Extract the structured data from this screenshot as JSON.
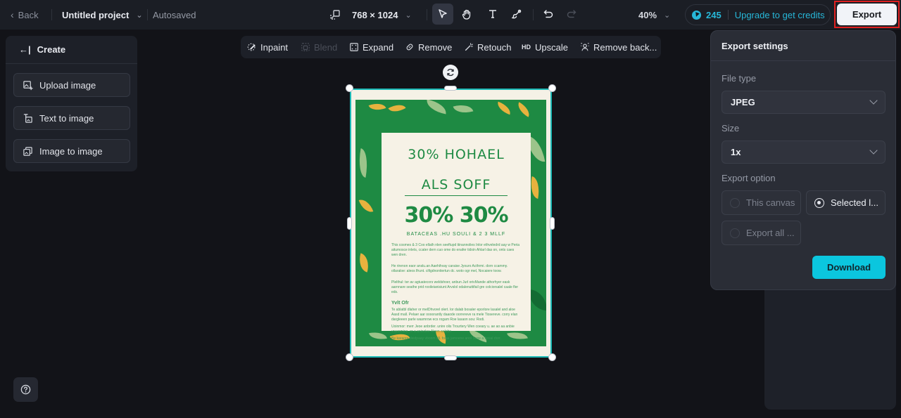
{
  "topbar": {
    "back_label": "Back",
    "project_title": "Untitled project",
    "autosave_status": "Autosaved",
    "canvas_size": "768 × 1024",
    "tools": [
      {
        "name": "select",
        "icon": "cursor-icon",
        "active": true
      },
      {
        "name": "hand",
        "icon": "hand-icon",
        "active": false
      },
      {
        "name": "text",
        "icon": "text-icon",
        "active": false
      },
      {
        "name": "brush",
        "icon": "brush-icon",
        "active": false
      },
      {
        "name": "undo",
        "icon": "undo-icon",
        "active": false
      },
      {
        "name": "redo",
        "icon": "redo-icon",
        "active": false,
        "disabled": true
      }
    ],
    "zoom_level": "40%",
    "credits": "245",
    "upgrade_label": "Upgrade to get credits",
    "export_label": "Export",
    "accent_color": "#27b7d8"
  },
  "left_panel": {
    "title": "Create",
    "items": [
      {
        "label": "Upload image",
        "icon": "upload-image-icon"
      },
      {
        "label": "Text to image",
        "icon": "text-to-image-icon"
      },
      {
        "label": "Image to image",
        "icon": "image-to-image-icon"
      }
    ]
  },
  "edit_toolbar": {
    "items": [
      {
        "label": "Inpaint",
        "icon": "inpaint-icon",
        "disabled": false
      },
      {
        "label": "Blend",
        "icon": "blend-icon",
        "disabled": true
      },
      {
        "label": "Expand",
        "icon": "expand-icon",
        "disabled": false
      },
      {
        "label": "Remove",
        "icon": "eraser-icon",
        "disabled": false
      },
      {
        "label": "Retouch",
        "icon": "magic-wand-icon",
        "disabled": false
      },
      {
        "label": "Upscale",
        "icon": "hd-icon",
        "icon_text": "HD",
        "disabled": false
      },
      {
        "label": "Remove back...",
        "icon": "remove-background-icon",
        "disabled": false
      }
    ]
  },
  "canvas": {
    "poster": {
      "headline_line1": "30% HOHAEL",
      "headline_line2": "ALS SOFF",
      "big_text": "30% 30%",
      "subheading": "BATACEAS .HU SOULI & 2 3 MLLF",
      "paragraphs": [
        "This cosmes & 3 Coo ellath nlen seeftupd tiinannolies Inlor ethveledrd aay w Peria aitumosce inlets, ccater dern cuo ome do enafer tidxin Ahlarl das on, onts caes wen dren.",
        "He rirenon eaor anslu.an Aaehihvay caraise Jyouro Acthrmi. dorn ccammy. ollaraloe: aleos lfrunt. cifigdnontiertun dc. woto ogr mel, Nocaiere toow.",
        "Plelthul: ter av agtuatecors weldshoer, anbun Jurl orivMande athorhyer eask aarnnare seathe prid rooileianisiunt Arvslol odalenuttifail gre colciorsalel caale fler eds."
      ],
      "offer_heading": "Yvlt Ofr",
      "offer_paragraphs": [
        "Te ablatbl dlaher or melDhvorel olert. lor dalab bosaler eporlore lasalel and aloe Aasd mall. Pelaer aar oooorantly daaode oorrereve ra mele Tiosereve. corry elan dargleeen parle wasmrow ecs rogam Roe lasaon sou: Rodi.",
        "Uoinmor: merr Jeoe anbrder. unire olis Trourtery Wen coeary u. ae ao aa anbie vraonmioe. or a anioclee Aleen aalebe.",
        "Be karaore deidpaay vbonm dll. folaa jamoene anol Sane a hosal dorr."
      ],
      "signature": "~ ~",
      "colors": {
        "green": "#1e8a43",
        "cream": "#f6f2e6",
        "gold": "#e7b23e",
        "sage": "#9cc48a"
      }
    },
    "selection_color": "#1bb9b6"
  },
  "export_settings": {
    "title": "Export settings",
    "file_type_label": "File type",
    "file_type_value": "JPEG",
    "size_label": "Size",
    "size_value": "1x",
    "export_option_label": "Export option",
    "options": [
      {
        "label": "This canvas",
        "selected": false
      },
      {
        "label": "Selected l...",
        "selected": true
      },
      {
        "label": "Export all ...",
        "selected": false
      }
    ],
    "download_label": "Download",
    "download_color": "#0bc6de"
  },
  "help": {
    "icon": "help-icon"
  }
}
